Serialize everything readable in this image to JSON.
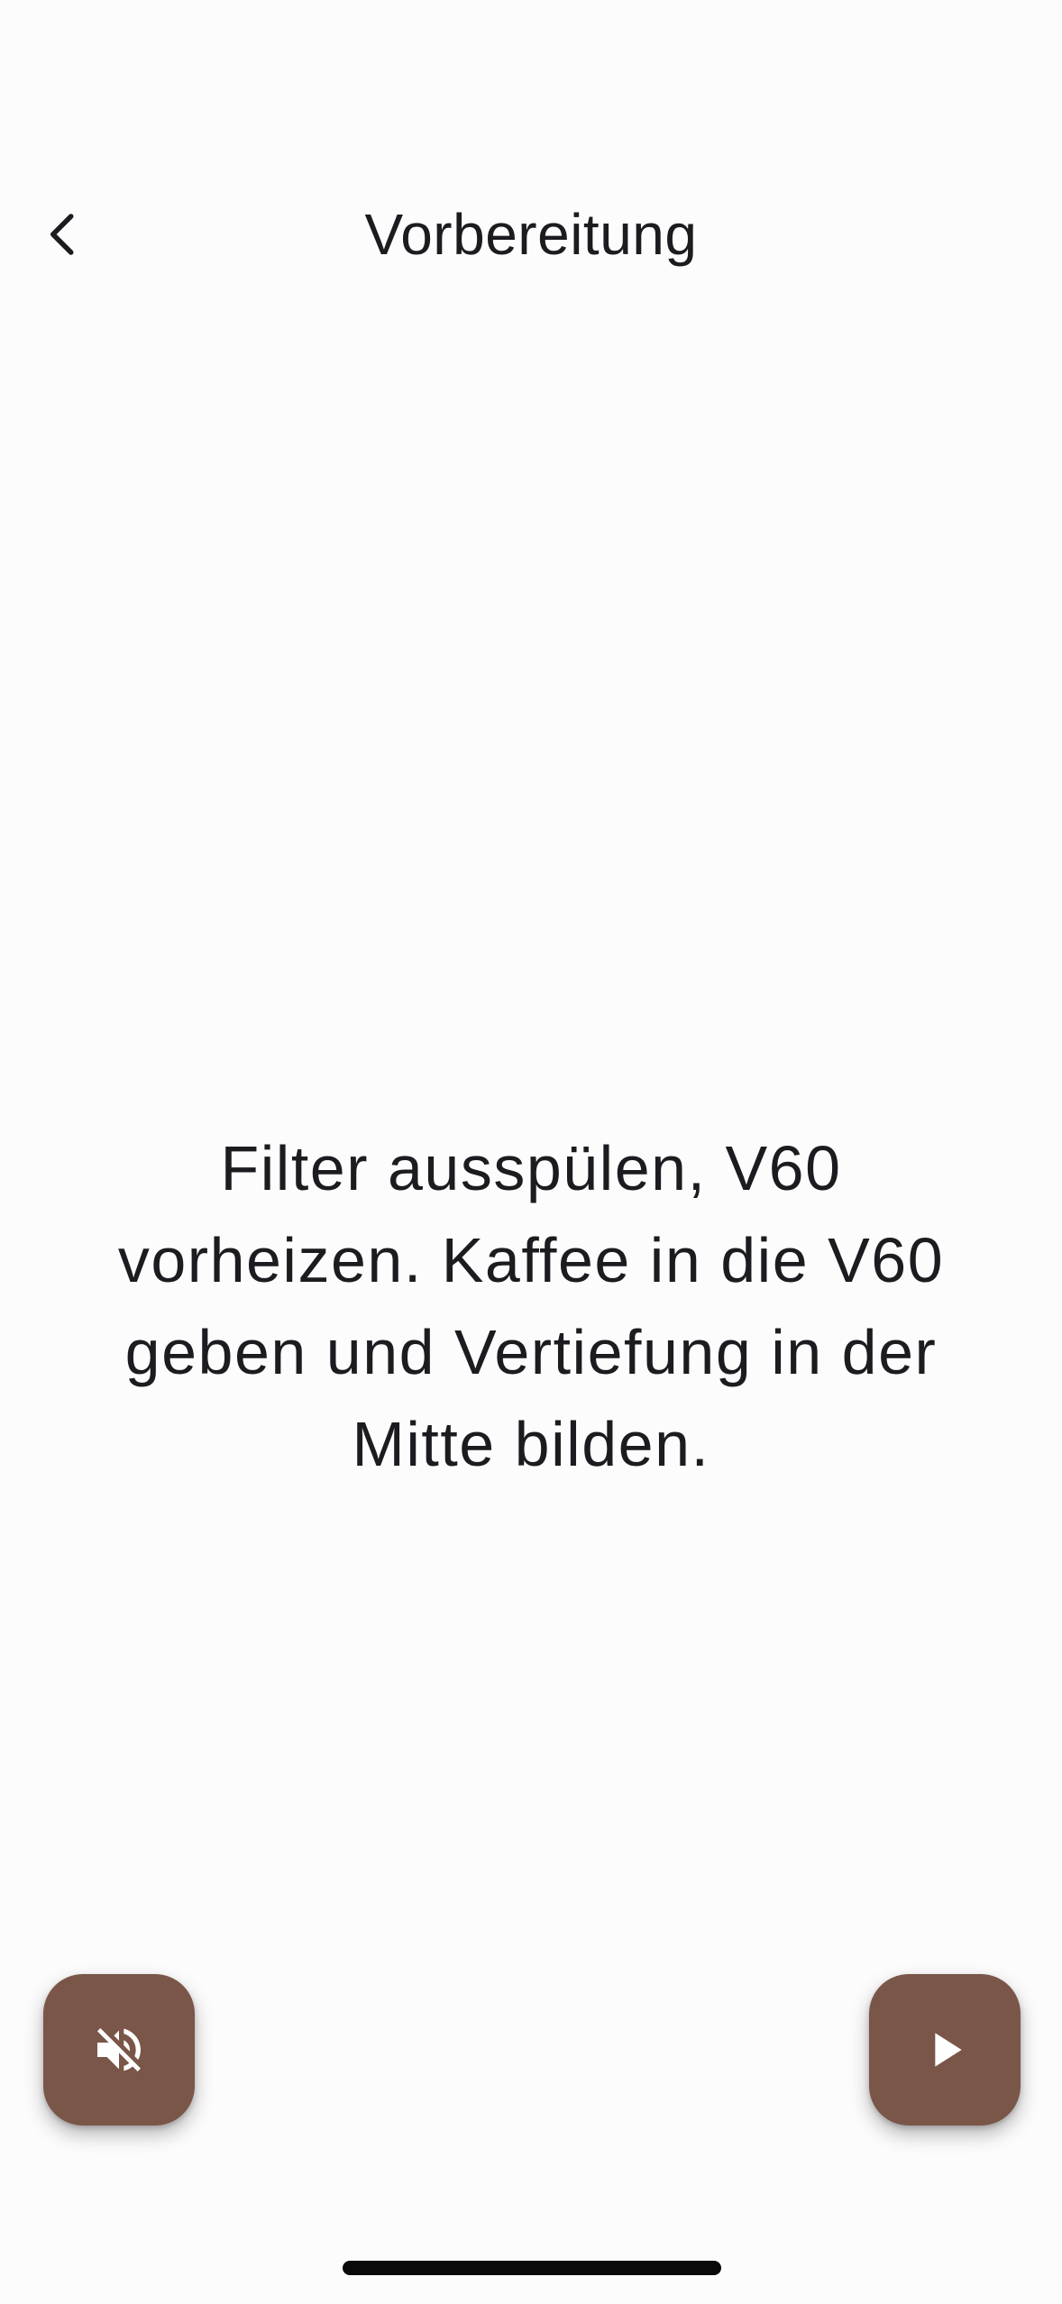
{
  "header": {
    "title": "Vorbereitung",
    "back_icon": "chevron-left-icon"
  },
  "main": {
    "instruction": "Filter ausspülen, V60 vorheizen. Kaffee in die V60 geben und Vertiefung in der Mitte bilden."
  },
  "controls": {
    "mute_icon": "volume-off-icon",
    "play_icon": "play-icon",
    "fab_color": "#7a5648"
  }
}
